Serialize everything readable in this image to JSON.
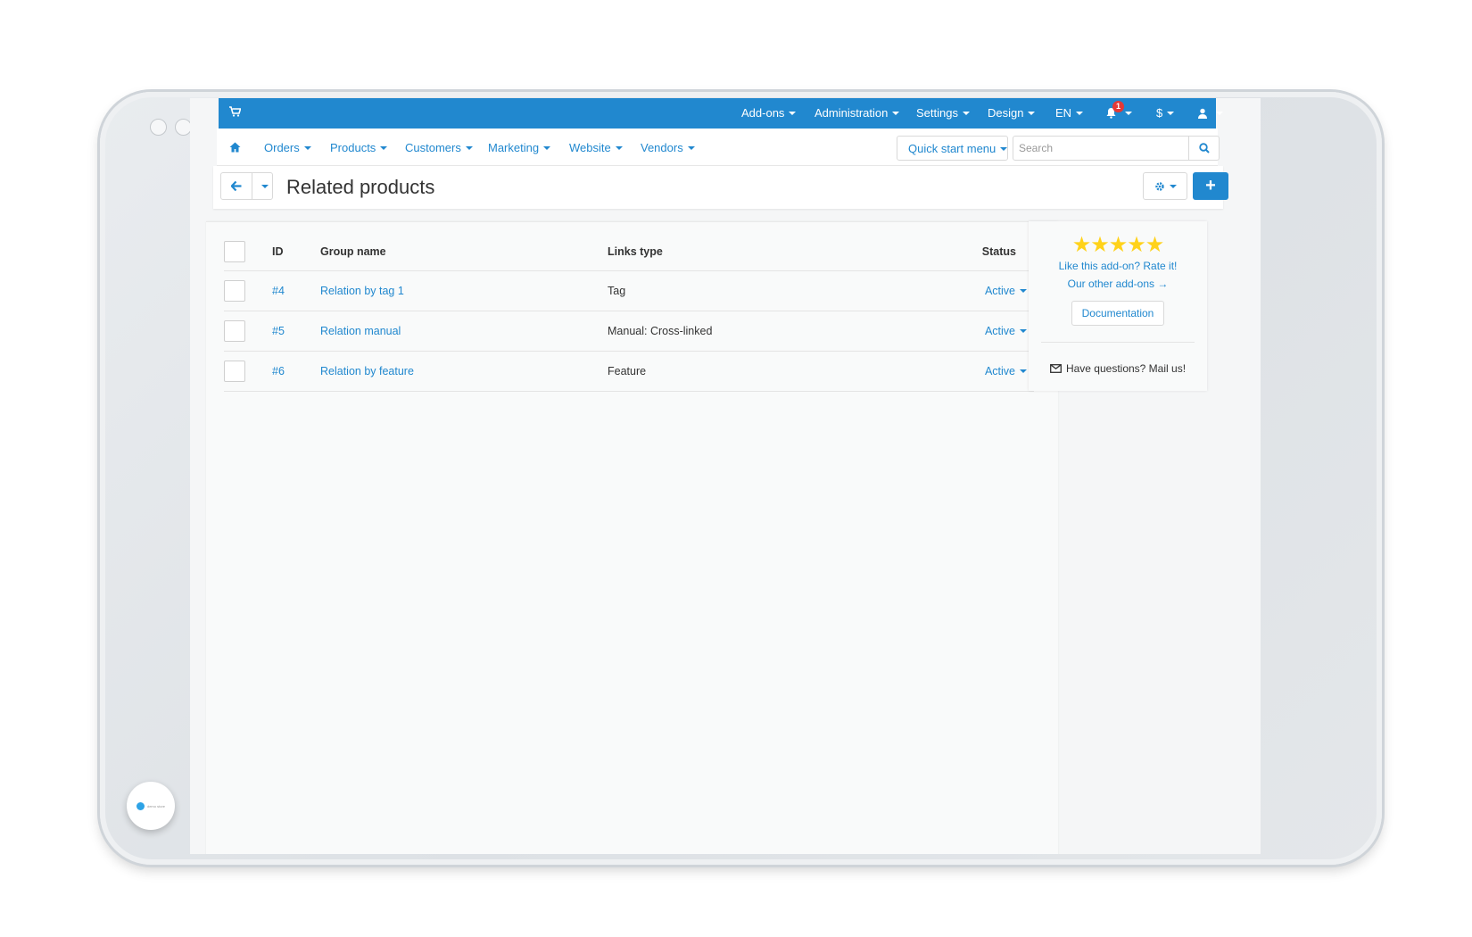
{
  "topbar": {
    "menus": [
      "Add-ons",
      "Administration",
      "Settings",
      "Design",
      "EN"
    ],
    "notification_count": "1",
    "currency": "$"
  },
  "nav": {
    "items": [
      "Orders",
      "Products",
      "Customers",
      "Marketing",
      "Website",
      "Vendors"
    ],
    "quick_start": "Quick start menu",
    "search_placeholder": "Search"
  },
  "page": {
    "title": "Related products"
  },
  "table": {
    "headers": [
      "ID",
      "Group name",
      "Links type",
      "Status"
    ],
    "rows": [
      {
        "id": "#4",
        "name": "Relation by tag 1",
        "links_type": "Tag",
        "status": "Active"
      },
      {
        "id": "#5",
        "name": "Relation manual",
        "links_type": "Manual: Cross-linked",
        "status": "Active"
      },
      {
        "id": "#6",
        "name": "Relation by feature",
        "links_type": "Feature",
        "status": "Active"
      }
    ]
  },
  "sidebar": {
    "stars": "★★★★★",
    "rate_text": "Like this add-on? Rate it!",
    "other_text": "Our other add-ons →",
    "doc_button": "Documentation",
    "mail_text": "Have questions? Mail us!"
  },
  "colors": {
    "primary": "#2188cf",
    "star": "#ffd21a",
    "badge": "#e53935"
  }
}
